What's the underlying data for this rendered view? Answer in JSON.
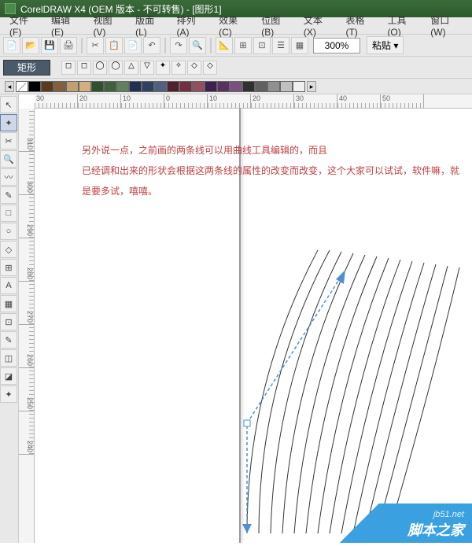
{
  "title": "CorelDRAW X4 (OEM 版本 - 不可转售) - [图形1]",
  "menus": [
    "文件(F)",
    "编辑(E)",
    "视图(V)",
    "版面(L)",
    "排列(A)",
    "效果(C)",
    "位图(B)",
    "文本(X)",
    "表格(T)",
    "工具(O)",
    "窗口(W)"
  ],
  "toolbar1": {
    "buttons": [
      "📄",
      "📂",
      "💾",
      "🖨",
      "✂",
      "📋",
      "📄",
      "↶",
      "↷",
      "🔍",
      "📐",
      "⊞",
      "⊡",
      "☰",
      "▦"
    ],
    "zoom": "300%",
    "paste": "粘贴 ▾"
  },
  "toolbar2": {
    "shape": "矩形",
    "shape_buttons": [
      "◻",
      "◻",
      "◯",
      "◯",
      "△",
      "▽",
      "✦",
      "✧",
      "◇",
      "◇"
    ]
  },
  "palette": [
    "#000000",
    "#5a3a1a",
    "#806040",
    "#c0a070",
    "#d0b080",
    "#305030",
    "#406040",
    "#608060",
    "#203050",
    "#304060",
    "#506080",
    "#502030",
    "#703040",
    "#905060",
    "#402050",
    "#5a3060",
    "#7a5080",
    "#303030",
    "#606060",
    "#909090",
    "#c0c0c0",
    "#f0f0f0"
  ],
  "ruler_h": [
    "30",
    "20",
    "10",
    "0",
    "10",
    "20",
    "30",
    "40",
    "50"
  ],
  "ruler_v": [
    "310",
    "300",
    "290",
    "280",
    "270",
    "260",
    "250",
    "240"
  ],
  "annotation": {
    "l1": "另外说一点，之前画的两条线可以用曲线工具编辑的，而且",
    "l2": "已经调和出来的形状会根据这两条线的属性的改变而改变，这个大家可以试试，软件嘛，就是要多试，嘻嘻。"
  },
  "watermark": {
    "url": "jb51.net",
    "txt": "脚本之家"
  },
  "toolbox": [
    {
      "icon": "↖",
      "name": "pick-tool"
    },
    {
      "icon": "✦",
      "name": "shape-tool"
    },
    {
      "icon": "✂",
      "name": "crop-tool"
    },
    {
      "icon": "🔍",
      "name": "zoom-tool"
    },
    {
      "icon": "〰",
      "name": "freehand-tool"
    },
    {
      "icon": "✎",
      "name": "smart-fill-tool"
    },
    {
      "icon": "□",
      "name": "rectangle-tool"
    },
    {
      "icon": "○",
      "name": "ellipse-tool"
    },
    {
      "icon": "◇",
      "name": "polygon-tool"
    },
    {
      "icon": "⊞",
      "name": "basic-shapes-tool"
    },
    {
      "icon": "A",
      "name": "text-tool"
    },
    {
      "icon": "▦",
      "name": "table-tool"
    },
    {
      "icon": "⊡",
      "name": "interactive-tool"
    },
    {
      "icon": "✎",
      "name": "eyedropper-tool"
    },
    {
      "icon": "◫",
      "name": "outline-tool"
    },
    {
      "icon": "◪",
      "name": "fill-tool"
    },
    {
      "icon": "✦",
      "name": "interactive-fill-tool"
    }
  ]
}
